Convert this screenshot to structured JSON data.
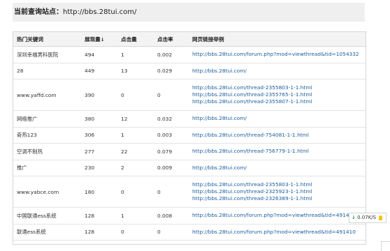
{
  "header": {
    "label": "当前查询站点：",
    "url": "http://bbs.28tui.com/"
  },
  "table": {
    "columns": [
      "热门关键词",
      "展现量",
      "点击量",
      "点击率",
      "网页链接举例"
    ],
    "sort_indicator": "↓",
    "rows": [
      {
        "keyword": "深圳幸福男科医院",
        "impressions": "494",
        "clicks": "1",
        "ctr": "0.002",
        "links": [
          "http://bbs.28tui.com/forum.php?mod=viewthread&tid=1054332"
        ]
      },
      {
        "keyword": "28",
        "impressions": "449",
        "clicks": "13",
        "ctr": "0.029",
        "links": [
          "http://bbs.28tui.com/"
        ]
      },
      {
        "keyword": "www.yaffd.com",
        "impressions": "390",
        "clicks": "0",
        "ctr": "0",
        "links": [
          "http://bbs.28tui.com/thread-2355803-1-1.html",
          "http://bbs.28tui.com/thread-2355765-1-1.html",
          "http://bbs.28tui.com/thread-2355807-1-1.html"
        ]
      },
      {
        "keyword": "网络推广",
        "impressions": "380",
        "clicks": "12",
        "ctr": "0.032",
        "links": [
          "http://bbs.28tui.com/"
        ]
      },
      {
        "keyword": "奇热123",
        "impressions": "306",
        "clicks": "1",
        "ctr": "0.003",
        "links": [
          "http://bbs.28tui.com/thread-754081-1-1.html"
        ]
      },
      {
        "keyword": "空调不制热",
        "impressions": "277",
        "clicks": "22",
        "ctr": "0.079",
        "links": [
          "http://bbs.28tui.com/thread-756779-1-1.html"
        ]
      },
      {
        "keyword": "推广",
        "impressions": "230",
        "clicks": "2",
        "ctr": "0.009",
        "links": [
          "http://bbs.28tui.com/"
        ]
      },
      {
        "keyword": "www.yabce.com",
        "impressions": "180",
        "clicks": "0",
        "ctr": "0",
        "links": [
          "http://bbs.28tui.com/thread-2355803-1-1.html",
          "http://bbs.28tui.com/thread-2325923-1-1.html",
          "http://bbs.28tui.com/thread-2326389-1-1.html"
        ]
      },
      {
        "keyword": "中国联通ess系统",
        "impressions": "128",
        "clicks": "1",
        "ctr": "0.008",
        "links": [
          "http://bbs.28tui.com/forum.php?mod=viewthread&tid=491410"
        ]
      },
      {
        "keyword": "联通ess系统",
        "impressions": "128",
        "clicks": "0",
        "ctr": "0",
        "links": [
          "http://bbs.28tui.com/forum.php?mod=viewthread&tid=491410"
        ]
      }
    ]
  },
  "float_widget": {
    "arrow": "↓",
    "speed": "0.07K/S"
  }
}
